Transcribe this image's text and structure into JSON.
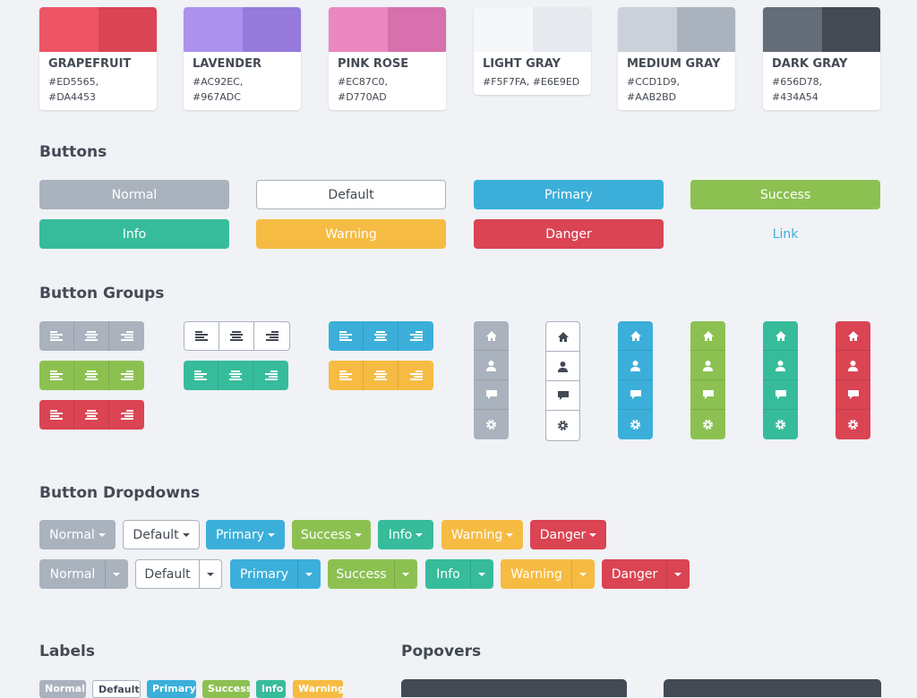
{
  "swatches": [
    {
      "name": "GRAPEFRUIT",
      "hex": "#ED5565, #DA4453",
      "c1": "#ED5565",
      "c2": "#DA4453"
    },
    {
      "name": "LAVENDER",
      "hex": "#AC92EC, #967ADC",
      "c1": "#AC92EC",
      "c2": "#967ADC"
    },
    {
      "name": "PINK ROSE",
      "hex": "#EC87C0, #D770AD",
      "c1": "#EC87C0",
      "c2": "#D770AD"
    },
    {
      "name": "LIGHT GRAY",
      "hex": "#F5F7FA, #E6E9ED",
      "c1": "#F5F7FA",
      "c2": "#E6E9ED"
    },
    {
      "name": "MEDIUM GRAY",
      "hex": "#CCD1D9, #AAB2BD",
      "c1": "#CCD1D9",
      "c2": "#AAB2BD"
    },
    {
      "name": "DARK GRAY",
      "hex": "#656D78, #434A54",
      "c1": "#656D78",
      "c2": "#434A54"
    }
  ],
  "sections": {
    "buttons": "Buttons",
    "groups": "Button Groups",
    "dropdowns": "Button Dropdowns",
    "labels": "Labels",
    "popovers": "Popovers"
  },
  "colors": {
    "normal": "#AAB2BD",
    "primary": "#3BAFDA",
    "success": "#8CC152",
    "info": "#37BC9B",
    "warning": "#F6BB42",
    "danger": "#DA4453",
    "link": "#3BAFDA",
    "dark": "#434A54"
  },
  "buttons": [
    "Normal",
    "Default",
    "Primary",
    "Success",
    "Info",
    "Warning",
    "Danger",
    "Link"
  ],
  "dropdowns": [
    "Normal",
    "Default",
    "Primary",
    "Success",
    "Info",
    "Warning",
    "Danger"
  ],
  "labels": [
    "Normal",
    "Default",
    "Primary",
    "Success",
    "Info",
    "Warning"
  ],
  "vertical_icons": [
    "home-icon",
    "user-icon",
    "comment-icon",
    "gear-icon"
  ]
}
